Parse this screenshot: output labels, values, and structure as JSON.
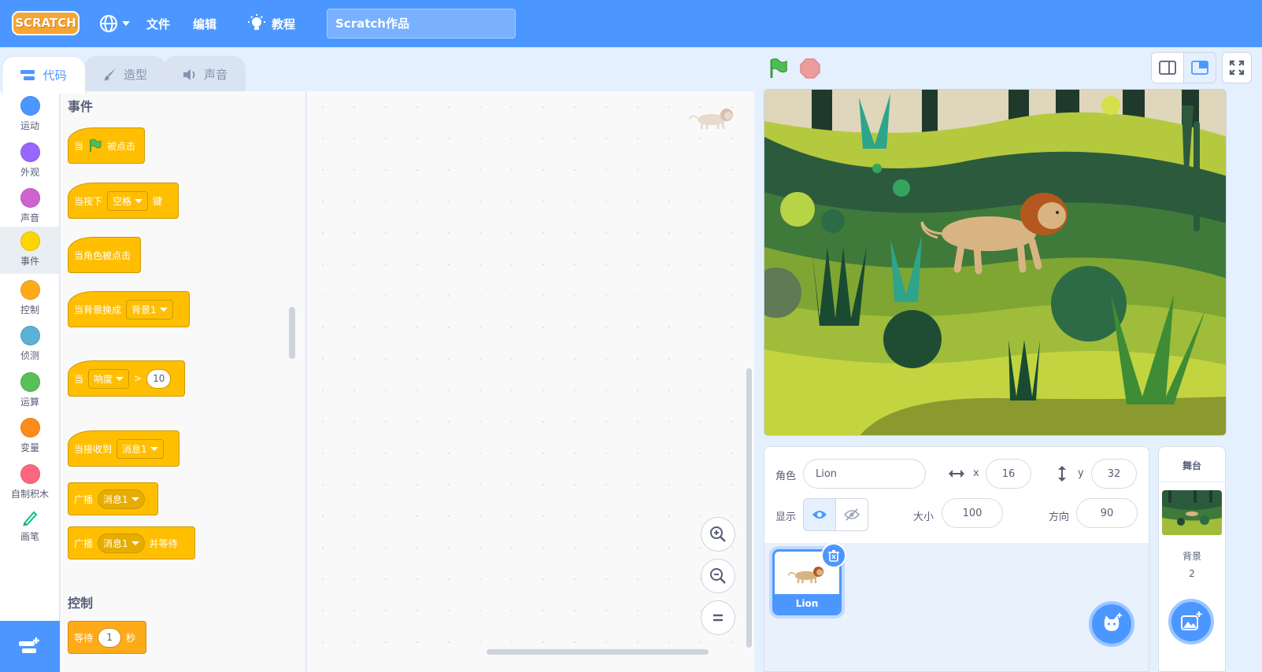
{
  "menubar": {
    "logo_text": "SCRATCH",
    "file_label": "文件",
    "edit_label": "编辑",
    "tutorials_label": "教程",
    "project_title": "Scratch作品"
  },
  "tabs": [
    {
      "label": "代码",
      "active": true
    },
    {
      "label": "造型",
      "active": false
    },
    {
      "label": "声音",
      "active": false
    }
  ],
  "categories": [
    {
      "label": "运动",
      "color": "#4c97ff"
    },
    {
      "label": "外观",
      "color": "#9966ff"
    },
    {
      "label": "声音",
      "color": "#cf63cf"
    },
    {
      "label": "事件",
      "color": "#ffd500"
    },
    {
      "label": "控制",
      "color": "#ffab19"
    },
    {
      "label": "侦测",
      "color": "#5cb1d6"
    },
    {
      "label": "运算",
      "color": "#59c059"
    },
    {
      "label": "变量",
      "color": "#ff8c1a"
    },
    {
      "label": "自制积木",
      "color": "#ff6680"
    },
    {
      "label": "画笔",
      "color": "pen"
    }
  ],
  "palette": {
    "events_title": "事件",
    "control_title": "控制",
    "b1_when": "当",
    "b1_clicked": "被点击",
    "b2_text": "当按下",
    "b2_drop": "空格",
    "b2_key": "键",
    "b3_text": "当角色被点击",
    "b4_text": "当背景换成",
    "b4_drop": "背景1",
    "b5_when": "当",
    "b5_drop": "响度",
    "b5_op": ">",
    "b5_num": "10",
    "b6_text": "当接收到",
    "b6_drop": "消息1",
    "b7_text": "广播",
    "b7_drop": "消息1",
    "b8_text": "广播",
    "b8_drop": "消息1",
    "b8_wait": "并等待",
    "b9_text": "等待",
    "b9_num": "1",
    "b9_sec": "秒"
  },
  "sprite_info": {
    "sprite_label": "角色",
    "sprite_name": "Lion",
    "x_label": "x",
    "x_value": "16",
    "y_label": "y",
    "y_value": "32",
    "show_label": "显示",
    "size_label": "大小",
    "size_value": "100",
    "direction_label": "方向",
    "direction_value": "90"
  },
  "sprites": [
    {
      "name": "Lion",
      "selected": true
    }
  ],
  "stage_pane": {
    "title": "舞台",
    "backdrops_label": "背景",
    "backdrops_count": "2"
  },
  "colors": {
    "accent": "#4c97ff",
    "events": "#ffbf00",
    "menubar": "#4c97ff"
  }
}
